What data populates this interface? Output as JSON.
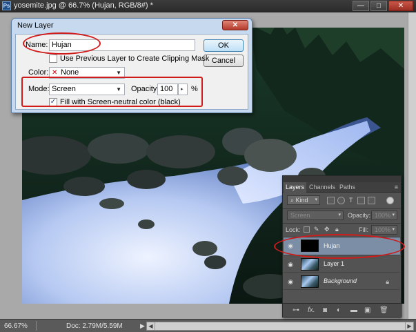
{
  "document": {
    "title": "yosemite.jpg @ 66.7% (Hujan, RGB/8#) *",
    "app_icon": "Ps"
  },
  "window_controls": {
    "minimize": "—",
    "maximize": "□",
    "close": "✕"
  },
  "status": {
    "zoom": "66.67%",
    "doc_size": "Doc: 2.79M/5.59M"
  },
  "dialog": {
    "title": "New Layer",
    "name_label": "Name:",
    "name_value": "Hujan",
    "ok_label": "OK",
    "cancel_label": "Cancel",
    "clipping_mask_label": "Use Previous Layer to Create Clipping Mask",
    "clipping_mask_checked": false,
    "color_label": "Color:",
    "color_value": "None",
    "mode_label": "Mode:",
    "mode_value": "Screen",
    "opacity_label": "Opacity:",
    "opacity_value": "100",
    "opacity_unit": "%",
    "fill_neutral_label": "Fill with Screen-neutral color (black)",
    "fill_neutral_checked": true
  },
  "layers_panel": {
    "tabs": [
      "Layers",
      "Channels",
      "Paths"
    ],
    "active_tab": "Layers",
    "filter_kind": "Kind",
    "blend_mode": "Screen",
    "opacity_label": "Opacity:",
    "opacity_value": "100%",
    "lock_label": "Lock:",
    "fill_label": "Fill:",
    "fill_value": "100%",
    "layers": [
      {
        "name": "Hujan",
        "selected": true,
        "thumbnail": "black",
        "locked": false
      },
      {
        "name": "Layer 1",
        "selected": false,
        "thumbnail": "photo",
        "locked": false
      },
      {
        "name": "Background",
        "selected": false,
        "thumbnail": "photo",
        "locked": true
      }
    ],
    "footer_buttons": [
      "link-icon",
      "fx-icon",
      "mask-icon",
      "adjustment-icon",
      "folder-icon",
      "new-layer-icon",
      "trash-icon"
    ],
    "footer_fx": "fx."
  },
  "annotation_color": "#d11b1b"
}
